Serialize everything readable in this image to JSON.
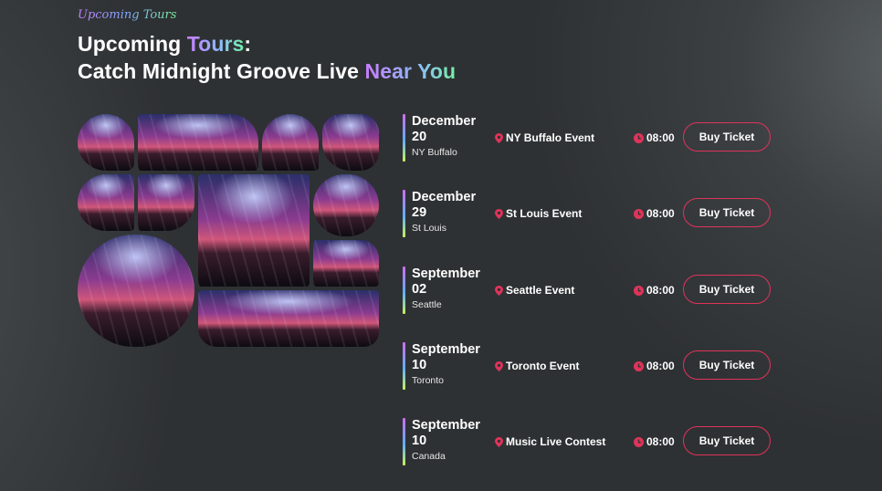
{
  "section": {
    "eyebrow": "Upcoming Tours",
    "title_line1_prefix": "Upcoming ",
    "title_line1_highlight": "Tours",
    "title_line1_suffix": ":",
    "title_line2_prefix": "Catch Midnight Groove Live ",
    "title_line2_highlight": "Near You"
  },
  "colors": {
    "accent": "#e0335a",
    "gradient_start": "#c77dff",
    "gradient_mid": "#7ea8ff",
    "gradient_end": "#74f0a8"
  },
  "icons": {
    "location": "map-pin-icon",
    "time": "clock-icon"
  },
  "tours": [
    {
      "month": "December",
      "day": "20",
      "city": "NY Buffalo",
      "event": "NY Buffalo Event",
      "time": "08:00",
      "button": "Buy Ticket"
    },
    {
      "month": "December",
      "day": "29",
      "city": "St Louis",
      "event": "St Louis Event",
      "time": "08:00",
      "button": "Buy Ticket"
    },
    {
      "month": "September",
      "day": "02",
      "city": "Seattle",
      "event": "Seattle Event",
      "time": "08:00",
      "button": "Buy Ticket"
    },
    {
      "month": "September",
      "day": "10",
      "city": "Toronto",
      "event": "Toronto Event",
      "time": "08:00",
      "button": "Buy Ticket"
    },
    {
      "month": "September",
      "day": "10",
      "city": "Canada",
      "event": "Music Live Contest",
      "time": "08:00",
      "button": "Buy Ticket"
    }
  ]
}
